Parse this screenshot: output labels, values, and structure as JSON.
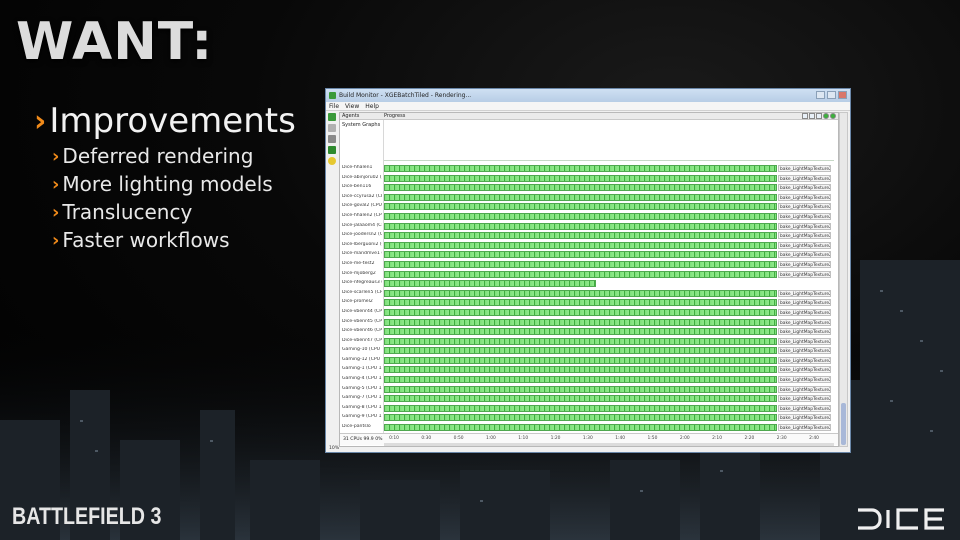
{
  "slide": {
    "title": "WANT:",
    "bullets": {
      "main": "Improvements",
      "subs": [
        "Deferred rendering",
        "More lighting models",
        "Translucency",
        "Faster workflows"
      ]
    },
    "logo_left": "BATTLEFIELD 3",
    "logo_right": "DICE",
    "accent_color": "#f08a1a"
  },
  "window": {
    "title": "Build Monitor - XGEBatchTiled - Rendering...",
    "menu": [
      "File",
      "View",
      "Help"
    ],
    "columns": {
      "agents": "Agents",
      "progress": "Progress"
    },
    "system_graphs": "System Graphs",
    "rows": [
      {
        "agent": "Dice-hhalen1",
        "job": "bake_LightMapTexture2D",
        "fill": 1.0
      },
      {
        "agent": "Dice-abinjoru02 (CP",
        "job": "bake_LightMapTexture2D",
        "fill": 1.0
      },
      {
        "agent": "Dice-ben116",
        "job": "bake_LightMapTexture2D",
        "fill": 1.0
      },
      {
        "agent": "Dice-ccyrusa2 (CPU",
        "job": "bake_LightMapTexture2D",
        "fill": 1.0
      },
      {
        "agent": "Dice-goval2 (CPU 1)",
        "job": "bake_LightMapTexture2D",
        "fill": 1.0
      },
      {
        "agent": "Dice-hhalen2 (CPU 1",
        "job": "bake_LightMapTexture2D",
        "fill": 1.0
      },
      {
        "agent": "Dice-jalaaom4 (CPU",
        "job": "bake_LightMapTexture2D",
        "fill": 1.0
      },
      {
        "agent": "Dice-joodersn2 (CPU",
        "job": "bake_LightMapTexture2D",
        "fill": 1.0
      },
      {
        "agent": "Dice-lberguoni2 (CP",
        "job": "bake_LightMapTexture2D",
        "fill": 1.0
      },
      {
        "agent": "Dice-mandmve1 (CP",
        "job": "bake_LightMapTexture2D",
        "fill": 1.0
      },
      {
        "agent": "Dice-me-test2",
        "job": "bake_LightMapTexture2D",
        "fill": 1.0
      },
      {
        "agent": "Dice-mjoberg2",
        "job": "bake_LightMapTexture2D",
        "fill": 1.0
      },
      {
        "agent": "Dice-nfegreaus3 (CP",
        "job": "",
        "fill": 0.54
      },
      {
        "agent": "Dice-scarlen5 (CPU",
        "job": "bake_LightMapTexture2D",
        "fill": 1.0
      },
      {
        "agent": "Dice-promel2",
        "job": "bake_LightMapTexture2D",
        "fill": 1.0
      },
      {
        "agent": "Dice-vbenr44 (CPU 1",
        "job": "bake_LightMapTexture2D",
        "fill": 1.0
      },
      {
        "agent": "Dice-vbenr45 (CPU 1",
        "job": "bake_LightMapTexture2D",
        "fill": 1.0
      },
      {
        "agent": "Dice-vbenr46 (CPU 1",
        "job": "bake_LightMapTexture2D",
        "fill": 1.0
      },
      {
        "agent": "Dice-vbenr47 (CPU 1",
        "job": "bake_LightMapTexture2D",
        "fill": 1.0
      },
      {
        "agent": "Gaming-10 (CPU 1)",
        "job": "bake_LightMapTexture2D",
        "fill": 1.0
      },
      {
        "agent": "Gaming-12 (CPU 1)",
        "job": "bake_LightMapTexture2D",
        "fill": 1.0
      },
      {
        "agent": "Gaming-1 (CPU 1)",
        "job": "bake_LightMapTexture2D",
        "fill": 1.0
      },
      {
        "agent": "Gaming-4 (CPU 1)",
        "job": "bake_LightMapTexture2D",
        "fill": 1.0
      },
      {
        "agent": "Gaming-5 (CPU 1)",
        "job": "bake_LightMapTexture2D",
        "fill": 1.0
      },
      {
        "agent": "Gaming-7 (CPU 1)",
        "job": "bake_LightMapTexture2D",
        "fill": 1.0
      },
      {
        "agent": "Gaming-8 (CPU 1)",
        "job": "bake_LightMapTexture2D",
        "fill": 1.0
      },
      {
        "agent": "Gaming-9 (CPU 1)",
        "job": "bake_LightMapTexture2D",
        "fill": 1.0
      },
      {
        "agent": "Dice-pantslo",
        "job": "bake_LightMapTexture2D",
        "fill": 1.0
      }
    ],
    "cpus_label": "31 CPUs 99.9 0%",
    "time_ticks": [
      "0:10",
      "0:30",
      "0:50",
      "1:00",
      "1:10",
      "1:20",
      "1:30",
      "1:40",
      "1:50",
      "2:00",
      "2:10",
      "2:20",
      "2:30",
      "2:40"
    ],
    "status": "10%"
  }
}
